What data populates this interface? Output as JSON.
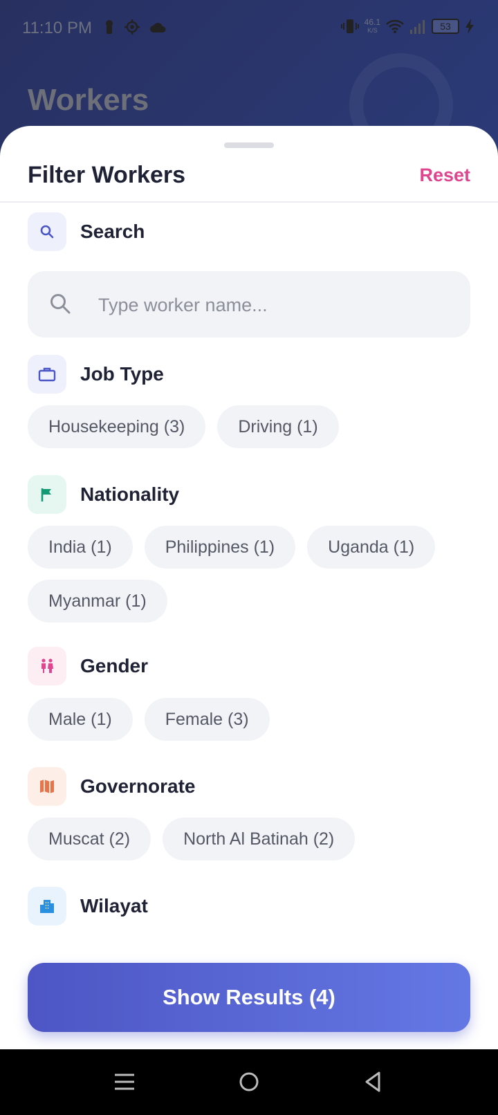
{
  "status_bar": {
    "time": "11:10 PM",
    "net_speed_value": "46.1",
    "net_speed_unit": "K/S",
    "battery": "53"
  },
  "page": {
    "title": "Workers"
  },
  "sheet": {
    "title": "Filter Workers",
    "reset_label": "Reset"
  },
  "search": {
    "label": "Search",
    "placeholder": "Type worker name...",
    "value": ""
  },
  "job_type": {
    "label": "Job Type",
    "options": [
      "Housekeeping (3)",
      "Driving (1)"
    ]
  },
  "nationality": {
    "label": "Nationality",
    "options": [
      "India (1)",
      "Philippines (1)",
      "Uganda (1)",
      "Myanmar (1)"
    ]
  },
  "gender": {
    "label": "Gender",
    "options": [
      "Male (1)",
      "Female (3)"
    ]
  },
  "governorate": {
    "label": "Governorate",
    "options": [
      "Muscat (2)",
      "North Al Batinah (2)"
    ]
  },
  "wilayat": {
    "label": "Wilayat"
  },
  "show_results_label": "Show Results (4)",
  "colors": {
    "accent": "#5b66d6",
    "reset": "#e0458f",
    "chip_bg": "#f2f3f7"
  },
  "icons": {
    "search": "search-icon",
    "job_type": "briefcase-icon",
    "nationality": "flag-icon",
    "gender": "people-icon",
    "governorate": "map-icon",
    "wilayat": "building-icon"
  }
}
